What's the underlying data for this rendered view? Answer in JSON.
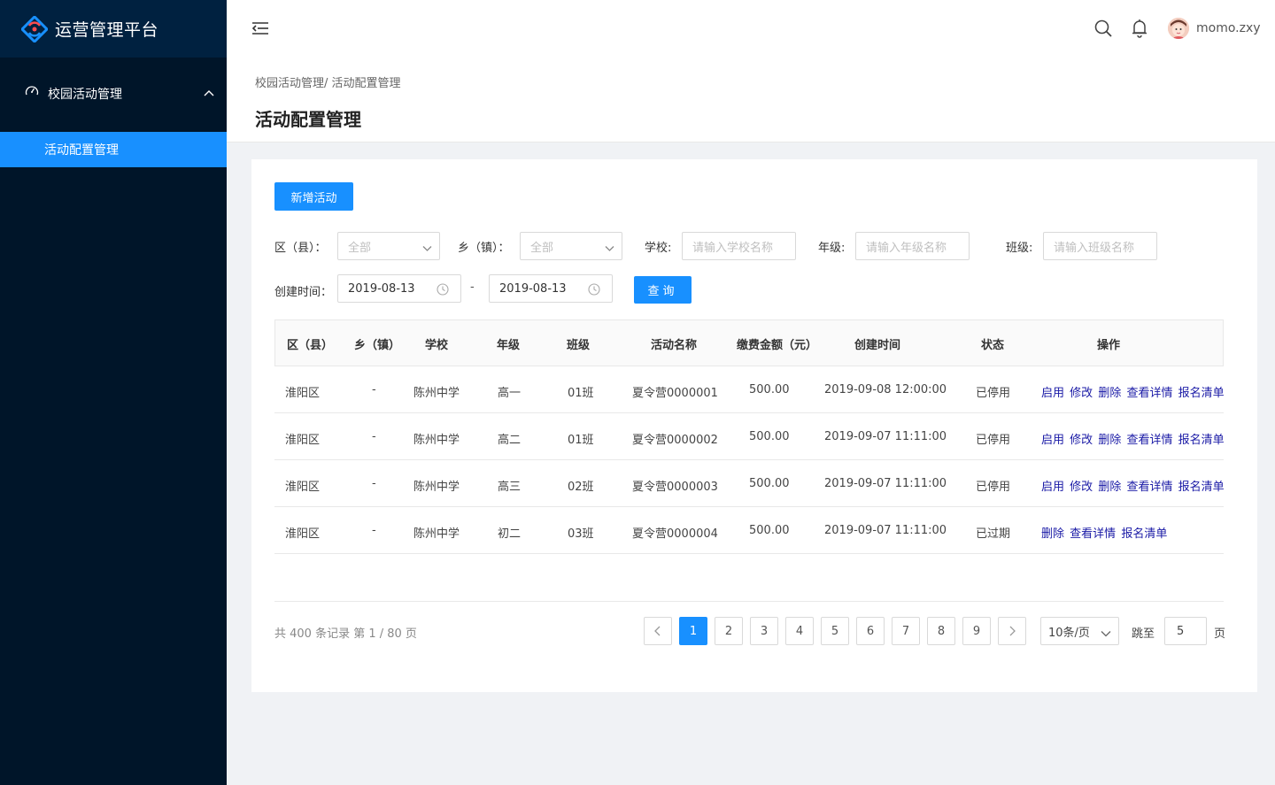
{
  "app": {
    "title": "运营管理平台"
  },
  "sidebar": {
    "group_label": "校园活动管理",
    "items": [
      {
        "label": "活动配置管理",
        "active": true
      }
    ]
  },
  "header": {
    "username": "momo.zxy"
  },
  "breadcrumb": "校园活动管理/ 活动配置管理",
  "page_title": "活动配置管理",
  "toolbar": {
    "add_label": "新增活动"
  },
  "filters": {
    "district_label": "区（县）：",
    "district_value": "全部",
    "town_label": "乡（镇）：",
    "town_value": "全部",
    "school_label": "学校:",
    "school_placeholder": "请输入学校名称",
    "grade_label": "年级:",
    "grade_placeholder": "请输入年级名称",
    "class_label": "班级:",
    "class_placeholder": "请输入班级名称",
    "created_label": "创建时间：",
    "date_start": "2019-08-13",
    "date_sep": "-",
    "date_end": "2019-08-13",
    "query_label": "查询"
  },
  "table": {
    "headers": [
      "区（县）",
      "乡（镇）",
      "学校",
      "年级",
      "班级",
      "活动名称",
      "缴费金额（元）",
      "创建时间",
      "状态",
      "操作"
    ],
    "rows": [
      {
        "district": "淮阳区",
        "town": "-",
        "school": "陈州中学",
        "grade": "高一",
        "class": "01班",
        "name": "夏令营0000001",
        "amount": "500.00",
        "created": "2019-09-08 12:00:00",
        "status": "已停用",
        "ops": [
          "启用",
          "修改",
          "删除",
          "查看详情",
          "报名清单"
        ]
      },
      {
        "district": "淮阳区",
        "town": "-",
        "school": "陈州中学",
        "grade": "高二",
        "class": "01班",
        "name": "夏令营0000002",
        "amount": "500.00",
        "created": "2019-09-07 11:11:00",
        "status": "已停用",
        "ops": [
          "启用",
          "修改",
          "删除",
          "查看详情",
          "报名清单"
        ]
      },
      {
        "district": "淮阳区",
        "town": "-",
        "school": "陈州中学",
        "grade": "高三",
        "class": "02班",
        "name": "夏令营0000003",
        "amount": "500.00",
        "created": "2019-09-07 11:11:00",
        "status": "已停用",
        "ops": [
          "启用",
          "修改",
          "删除",
          "查看详情",
          "报名清单"
        ]
      },
      {
        "district": "淮阳区",
        "town": "-",
        "school": "陈州中学",
        "grade": "初二",
        "class": "03班",
        "name": "夏令营0000004",
        "amount": "500.00",
        "created": "2019-09-07 11:11:00",
        "status": "已过期",
        "ops": [
          "删除",
          "查看详情",
          "报名清单"
        ]
      }
    ]
  },
  "pagination": {
    "total_text": "共 400 条记录 第 1 / 80 页",
    "pages": [
      "1",
      "2",
      "3",
      "4",
      "5",
      "6",
      "7",
      "8",
      "9"
    ],
    "current": "1",
    "page_size": "10条/页",
    "jump_label": "跳至",
    "jump_value": "5",
    "jump_unit": "页"
  },
  "colors": {
    "primary": "#1890ff",
    "sidebar_bg": "#001529",
    "logo_bg": "#002140",
    "link": "#1a1aa6"
  }
}
